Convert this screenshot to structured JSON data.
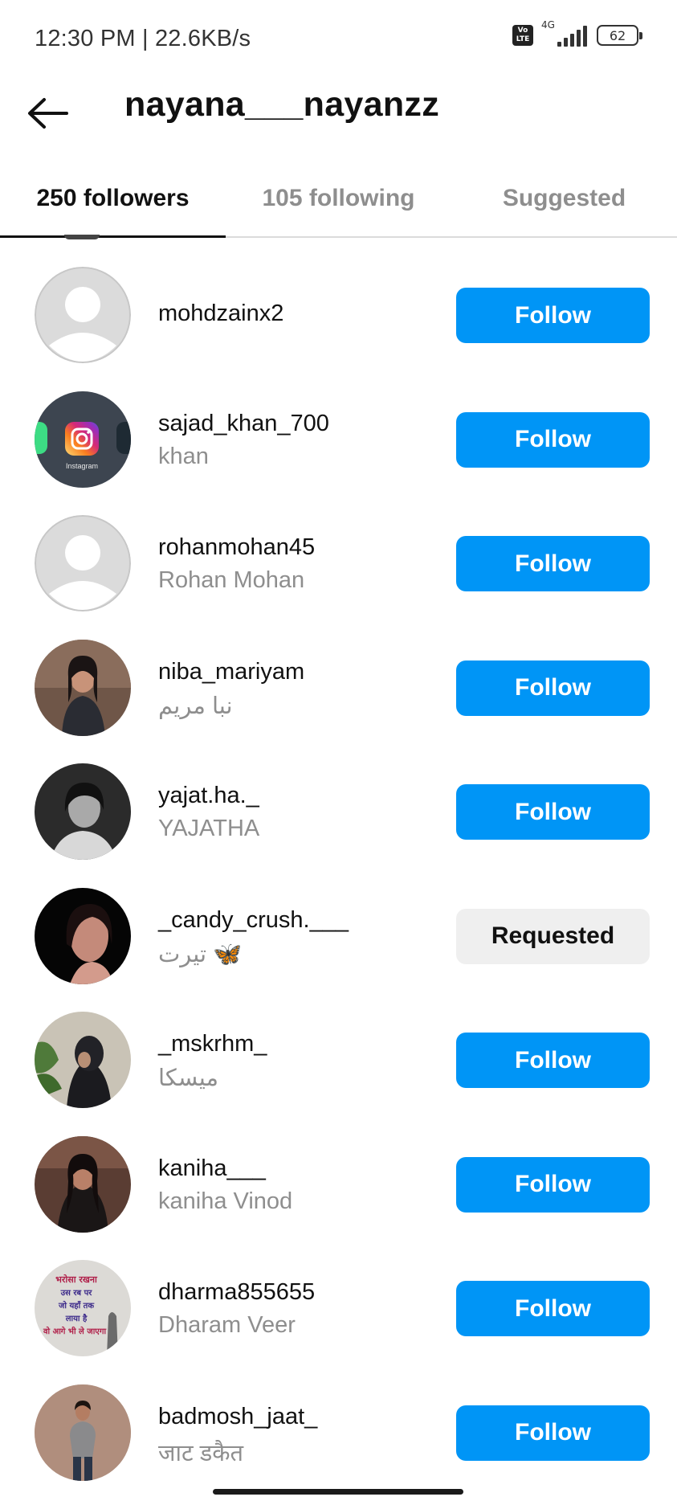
{
  "status_bar": {
    "time": "12:30 PM | 22.6KB/s",
    "volte": "Vo LTE",
    "network": "4G",
    "battery": "62"
  },
  "header": {
    "title": "nayana___nayanzz"
  },
  "tabs": [
    {
      "label": "250 followers",
      "active": true
    },
    {
      "label": "105 following",
      "active": false
    },
    {
      "label": "Suggested",
      "active": false
    }
  ],
  "followers": [
    {
      "username": "mohdzainx2",
      "fullname": "",
      "button": "Follow",
      "avatar": "default-avatar"
    },
    {
      "username": "sajad_khan_700",
      "fullname": "khan",
      "button": "Follow",
      "avatar": "instagram-logo-photo",
      "avatar_caption": "Instagram"
    },
    {
      "username": "rohanmohan45",
      "fullname": "Rohan Mohan",
      "button": "Follow",
      "avatar": "default-avatar"
    },
    {
      "username": "niba_mariyam",
      "fullname": "نبا مریم",
      "button": "Follow",
      "avatar": "profile-photo"
    },
    {
      "username": "yajat.ha._",
      "fullname": "YAJATHA",
      "button": "Follow",
      "avatar": "profile-photo"
    },
    {
      "username": "_candy_crush.___",
      "fullname": "تیرت 🦋",
      "button": "Requested",
      "avatar": "profile-photo"
    },
    {
      "username": "_mskrhm_",
      "fullname": "میسکا",
      "button": "Follow",
      "avatar": "profile-photo"
    },
    {
      "username": "kaniha___",
      "fullname": "kaniha Vinod",
      "button": "Follow",
      "avatar": "profile-photo"
    },
    {
      "username": "dharma855655",
      "fullname": "Dharam Veer",
      "button": "Follow",
      "avatar": "text-quote-photo",
      "avatar_text": [
        "भरोसा रखना",
        "उस रब पर",
        "जो यहाँ तक",
        "लाया है",
        "वो आगे भी ले जाएगा"
      ]
    },
    {
      "username": "badmosh_jaat_",
      "fullname": "जाट डकैत",
      "button": "Follow",
      "avatar": "profile-photo"
    }
  ],
  "colors": {
    "follow_blue": "#0095f6",
    "requested_gray": "#efefef",
    "secondary_text": "#8e8e8e"
  }
}
